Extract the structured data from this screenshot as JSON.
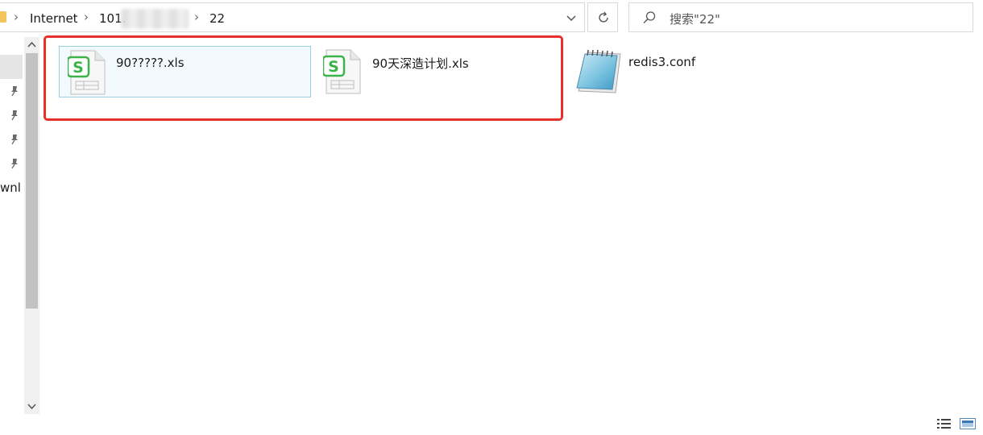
{
  "address_bar": {
    "crumbs": [
      "Internet",
      "101.",
      "22"
    ]
  },
  "search": {
    "placeholder": "搜索\"22\""
  },
  "navigation": {
    "truncated_label": "wnl"
  },
  "files": [
    {
      "name": "90?????.xls",
      "type": "wps-spreadsheet",
      "selected": true
    },
    {
      "name": "90天深造计划.xls",
      "type": "wps-spreadsheet",
      "selected": false
    },
    {
      "name": "redis3.conf",
      "type": "notepad-text-file",
      "selected": false
    }
  ],
  "colors": {
    "highlight_box": "#e8302a",
    "selection_border": "#99d1de",
    "selection_fill": "#f3fafd",
    "wps_green": "#3cb34a"
  },
  "icons": [
    "folder-icon",
    "chevron-right-icon",
    "chevron-down-icon",
    "refresh-icon",
    "search-icon",
    "pin-icon",
    "spreadsheet-icon",
    "notepad-icon",
    "details-view-icon",
    "tiles-view-icon"
  ]
}
